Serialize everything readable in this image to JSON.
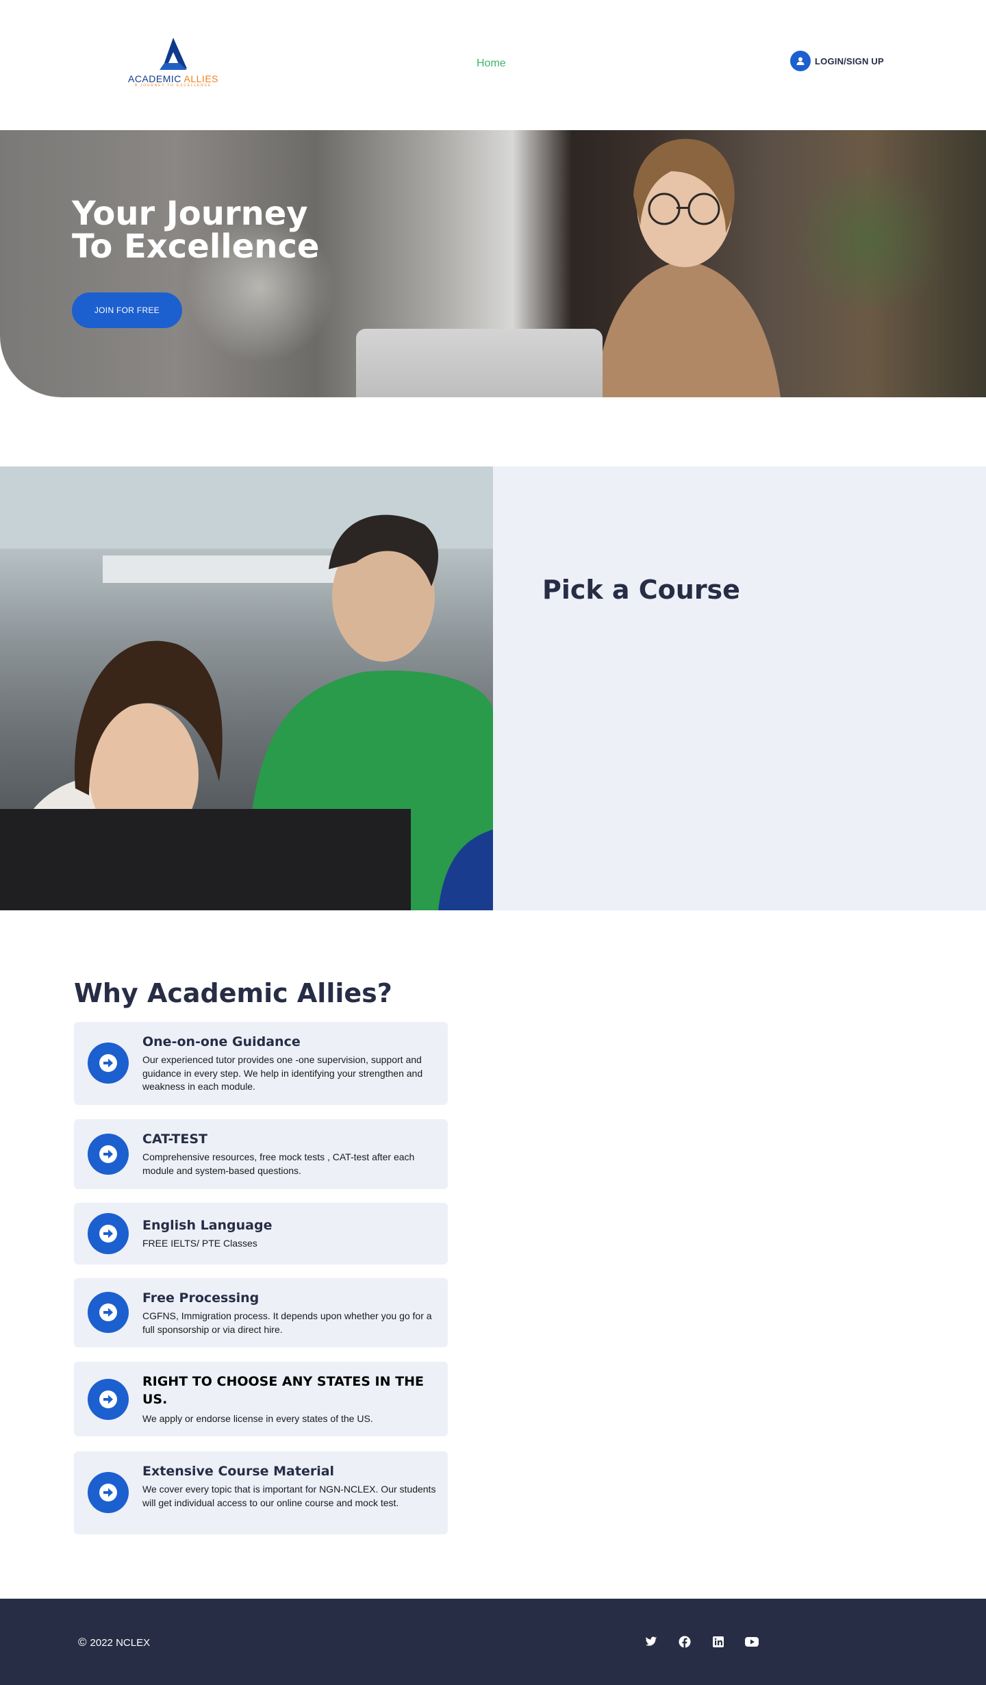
{
  "header": {
    "logo": {
      "brand_part1": "ACADEMIC",
      "brand_part2": "ALLIES",
      "tagline": "A JOURNEY TO EXCELLENCE"
    },
    "nav": {
      "home_label": "Home"
    },
    "login_label": "LOGIN/SIGN UP",
    "login_icon": "user-icon",
    "colors": {
      "nav_active": "#3fb36a",
      "accent": "#1c5fcf"
    }
  },
  "hero": {
    "title_line1": "Your Journey",
    "title_line2": "To Excellence",
    "cta_label": "JOIN FOR FREE"
  },
  "course": {
    "title": "Pick a Course"
  },
  "why": {
    "title": "Why Academic Allies?",
    "items": [
      {
        "title": "One-on-one Guidance",
        "desc": "Our experienced tutor provides one -one supervision, support and guidance in every step. We help in identifying your strengthen and weakness in each module.",
        "icon": "arrow-right-circle-icon"
      },
      {
        "title": "CAT-TEST",
        "desc": "Comprehensive resources, free mock tests , CAT-test after each module and system-based questions.",
        "icon": "arrow-right-circle-icon"
      },
      {
        "title": "English Language",
        "desc": "FREE IELTS/ PTE Classes",
        "icon": "arrow-right-circle-icon"
      },
      {
        "title": "Free Processing",
        "desc": "CGFNS, Immigration process. It depends upon whether you go for a full sponsorship or via direct hire.",
        "icon": "arrow-right-circle-icon"
      },
      {
        "title": "RIGHT TO CHOOSE ANY STATES IN THE US.",
        "desc": "We apply or endorse license in every states of the US.",
        "icon": "arrow-right-circle-icon"
      },
      {
        "title": "Extensive Course Material",
        "desc": "We cover every topic that is important for NGN-NCLEX. Our students will get individual access to our online course and mock test.",
        "icon": "arrow-right-circle-icon"
      }
    ]
  },
  "footer": {
    "copyright_symbol": "©",
    "copyright_text": "2022 NCLEX",
    "social_icons": [
      "twitter-icon",
      "facebook-icon",
      "linkedin-icon",
      "youtube-icon"
    ],
    "background": "#272d45"
  }
}
